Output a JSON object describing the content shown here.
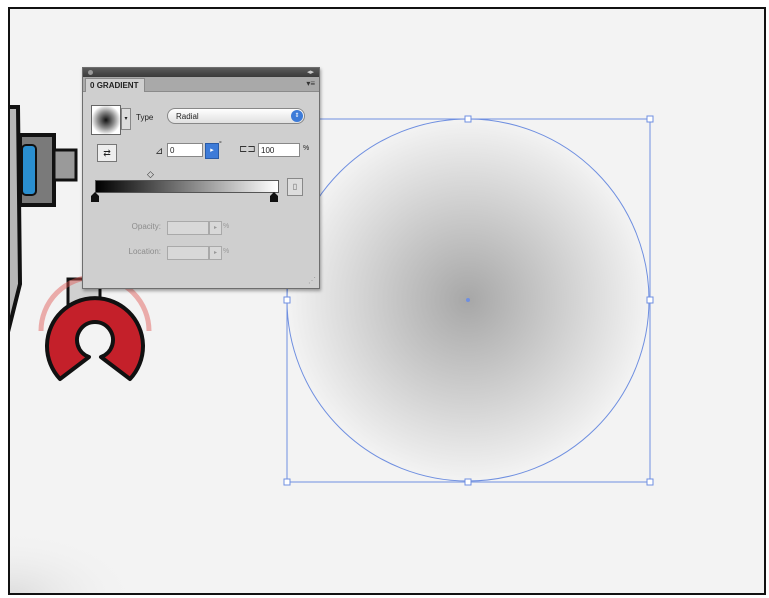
{
  "panel": {
    "tab_label": "GRADIENT",
    "tab_marker": "0",
    "menu_icon": "panel-menu-icon",
    "type_label": "Type",
    "type_value": "Radial",
    "angle_value": "0",
    "degree_symbol": "°",
    "aspect_value": "100",
    "aspect_unit": "%",
    "opacity_label": "Opacity:",
    "opacity_unit": "%",
    "location_label": "Location:",
    "location_unit": "%"
  },
  "colors": {
    "selection": "#6f8fe0",
    "gradient_center": "#a7a7a7",
    "gradient_edge": "#f3f3f3",
    "robot_red": "#c4202a",
    "robot_blue": "#2a8fd0"
  }
}
